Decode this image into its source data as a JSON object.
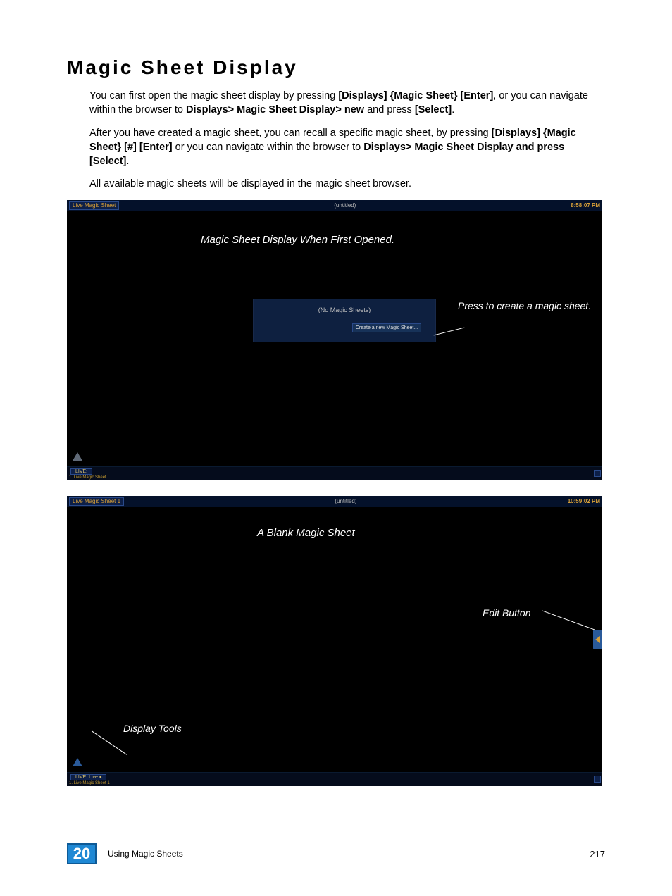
{
  "heading": "Magic Sheet Display",
  "para1_a": "You can first open the magic sheet display by pressing ",
  "para1_b": "[Displays] {Magic Sheet} [Enter]",
  "para1_c": ", or you can navigate within the browser to ",
  "para1_d": "Displays> Magic Sheet Display> new",
  "para1_e": " and press ",
  "para1_f": "[Select]",
  "para1_g": ".",
  "para2_a": "After you have created a magic sheet, you can recall a specific magic sheet, by pressing ",
  "para2_b": "[Displays] {Magic Sheet} [#] [Enter]",
  "para2_c": " or you can navigate within the browser to ",
  "para2_d": "Displays> Magic Sheet Display and press [Select]",
  "para2_e": ".",
  "para3": "All available magic sheets will be displayed in the magic sheet browser.",
  "ss1": {
    "tab": "Live Magic Sheet",
    "title": "(untitled)",
    "time": "8:58:07 PM",
    "ann_top": "Magic Sheet Display When First Opened.",
    "dialog_text": "(No Magic Sheets)",
    "dialog_btn": "Create a new Magic Sheet...",
    "ann_press": "Press to create a magic sheet.",
    "live": "LIVE:",
    "subline": "1. Live Magic Sheet"
  },
  "ss2": {
    "tab": "Live Magic Sheet 1",
    "title": "(untitled)",
    "time": "10:59:02 PM",
    "ann_top": "A Blank Magic Sheet",
    "ann_edit": "Edit Button",
    "ann_tools": "Display Tools",
    "live": "LIVE: Live ♦",
    "subline": "1. Live Magic Sheet 1"
  },
  "footer": {
    "chapter": "20",
    "text": "Using Magic Sheets",
    "page": "217"
  }
}
